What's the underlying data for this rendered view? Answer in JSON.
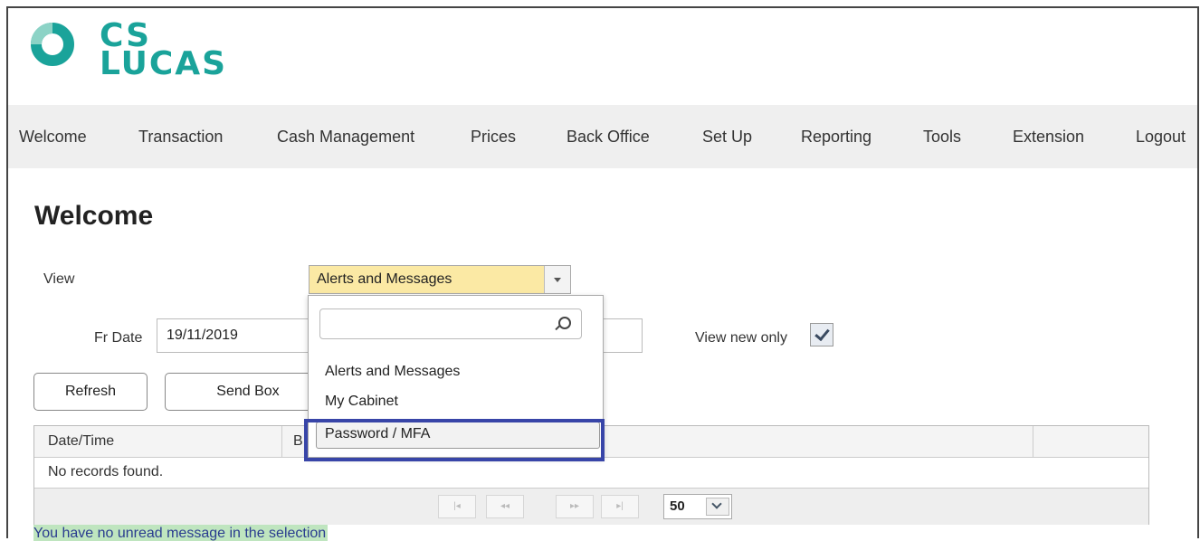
{
  "brand": {
    "line1": "CS",
    "line2": "LUCAS",
    "color": "#1aa39a"
  },
  "nav": {
    "items": [
      "Welcome",
      "Transaction",
      "Cash Management",
      "Prices",
      "Back Office",
      "Set Up",
      "Reporting",
      "Tools",
      "Extension",
      "Logout"
    ]
  },
  "page": {
    "title": "Welcome"
  },
  "filters": {
    "view_label": "View",
    "view_value": "Alerts and Messages",
    "fr_date_label": "Fr Date",
    "fr_date_value": "19/11/2019",
    "view_new_only_label": "View new only",
    "view_new_only_checked": true
  },
  "buttons": {
    "refresh": "Refresh",
    "send_box": "Send Box"
  },
  "grid": {
    "columns": [
      "Date/Time",
      "B"
    ],
    "empty_text": "No records found.",
    "page_size": "50"
  },
  "status_text": "You have no unread message in the selection",
  "dropdown": {
    "search_placeholder": "",
    "options": [
      "Alerts and Messages",
      "My Cabinet",
      "Password / MFA"
    ],
    "highlighted": "Password / MFA"
  },
  "colors": {
    "select_bg": "#fbe9a4",
    "annotation_border": "#3845a8",
    "nav_bg": "#efefef"
  }
}
